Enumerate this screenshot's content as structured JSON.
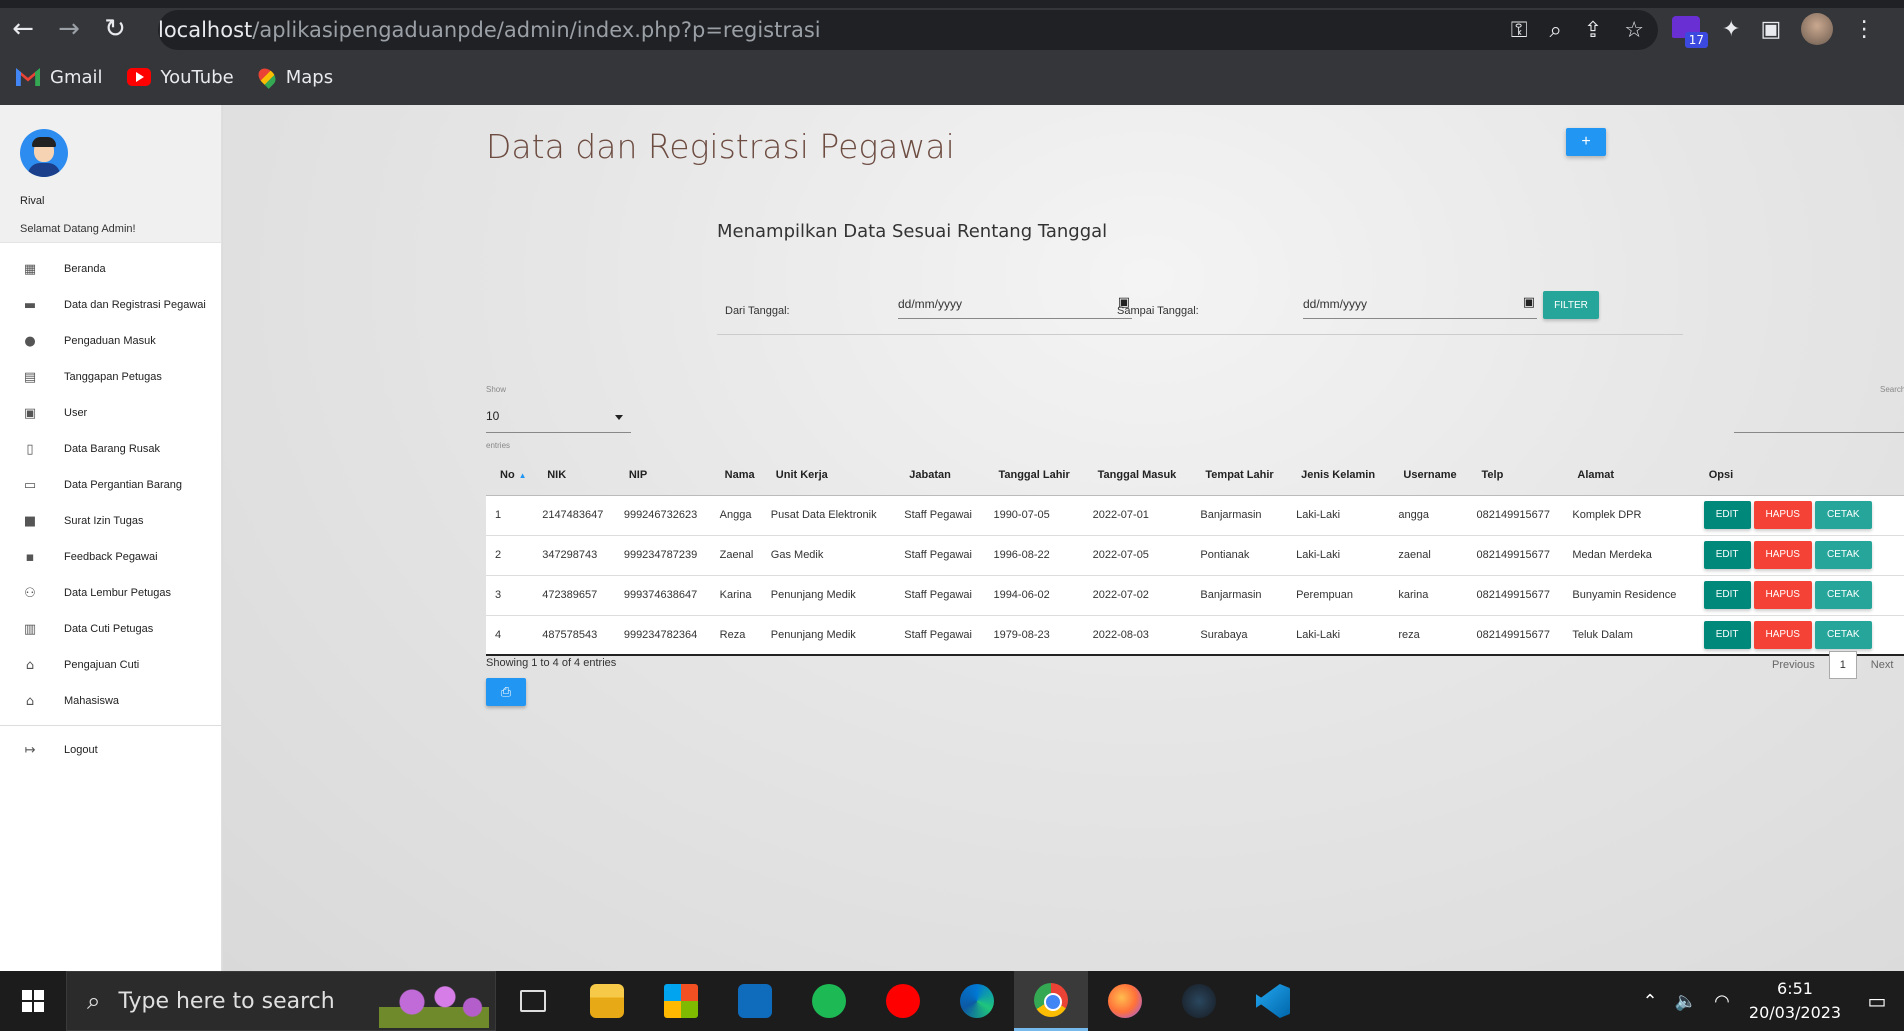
{
  "browser": {
    "url_host": "localhost",
    "url_path": "/aplikasipengaduanpde/admin/index.php?p=registrasi",
    "extension_badge": "17",
    "bookmarks": [
      {
        "label": "Gmail",
        "icon": "gmail-icon"
      },
      {
        "label": "YouTube",
        "icon": "youtube-icon"
      },
      {
        "label": "Maps",
        "icon": "maps-icon"
      }
    ]
  },
  "sidebar": {
    "user_name": "Rival",
    "welcome": "Selamat Datang Admin!",
    "items": [
      {
        "label": "Beranda",
        "icon": "dashboard-icon"
      },
      {
        "label": "Data dan Registrasi Pegawai",
        "icon": "id-card-icon"
      },
      {
        "label": "Pengaduan Masuk",
        "icon": "alert-icon"
      },
      {
        "label": "Tanggapan Petugas",
        "icon": "chat-icon"
      },
      {
        "label": "User",
        "icon": "user-icon"
      },
      {
        "label": "Data Barang Rusak",
        "icon": "clipboard-icon"
      },
      {
        "label": "Data Pergantian Barang",
        "icon": "laptop-icon"
      },
      {
        "label": "Surat Izin Tugas",
        "icon": "briefcase-icon"
      },
      {
        "label": "Feedback Pegawai",
        "icon": "feedback-icon"
      },
      {
        "label": "Data Lembur Petugas",
        "icon": "user-clock-icon"
      },
      {
        "label": "Data Cuti Petugas",
        "icon": "building-icon"
      },
      {
        "label": "Pengajuan Cuti",
        "icon": "home-icon"
      },
      {
        "label": "Mahasiswa",
        "icon": "home-icon"
      }
    ],
    "logout": "Logout"
  },
  "main": {
    "title": "Data dan Registrasi Pegawai",
    "add_button": "+",
    "range_title": "Menampilkan Data Sesuai Rentang Tanggal",
    "from_label": "Dari Tanggal:",
    "to_label": "Sampai Tanggal:",
    "date_placeholder": "dd/mm/yyyy",
    "filter_button": "FILTER",
    "show_label": "Show",
    "show_value": "10",
    "entries_label": "entries",
    "search_label": "Search:",
    "columns": [
      "No",
      "NIK",
      "NIP",
      "Nama",
      "Unit Kerja",
      "Jabatan",
      "Tanggal Lahir",
      "Tanggal Masuk",
      "Tempat Lahir",
      "Jenis Kelamin",
      "Username",
      "Telp",
      "Alamat",
      "Opsi"
    ],
    "rows": [
      [
        "1",
        "2147483647",
        "999246732623",
        "Angga",
        "Pusat Data Elektronik",
        "Staff Pegawai",
        "1990-07-05",
        "2022-07-01",
        "Banjarmasin",
        "Laki-Laki",
        "angga",
        "082149915677",
        "Komplek DPR"
      ],
      [
        "2",
        "347298743",
        "999234787239",
        "Zaenal",
        "Gas Medik",
        "Staff Pegawai",
        "1996-08-22",
        "2022-07-05",
        "Pontianak",
        "Laki-Laki",
        "zaenal",
        "082149915677",
        "Medan Merdeka"
      ],
      [
        "3",
        "472389657",
        "999374638647",
        "Karina",
        "Penunjang Medik",
        "Staff Pegawai",
        "1994-06-02",
        "2022-07-02",
        "Banjarmasin",
        "Perempuan",
        "karina",
        "082149915677",
        "Bunyamin Residence"
      ],
      [
        "4",
        "487578543",
        "999234782364",
        "Reza",
        "Penunjang Medik",
        "Staff Pegawai",
        "1979-08-23",
        "2022-08-03",
        "Surabaya",
        "Laki-Laki",
        "reza",
        "082149915677",
        "Teluk Dalam"
      ]
    ],
    "actions": {
      "edit": "EDIT",
      "hapus": "HAPUS",
      "cetak": "CETAK"
    },
    "showing": "Showing 1 to 4 of 4 entries",
    "previous": "Previous",
    "page": "1",
    "next": "Next"
  },
  "taskbar": {
    "search_placeholder": "Type here to search",
    "time": "6:51",
    "date": "20/03/2023"
  }
}
